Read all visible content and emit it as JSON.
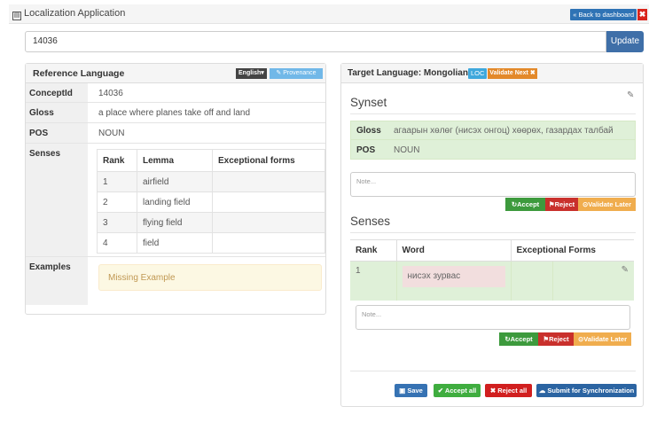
{
  "app": {
    "title": "Localization Application",
    "back_label": "« Back to dashboard",
    "close_label": "✖"
  },
  "search": {
    "value": "14036",
    "update_label": "Update"
  },
  "reference": {
    "title": "Reference Language",
    "lang_label": "English▾",
    "provenance_label": "✎ Provenance",
    "conceptid_label": "ConceptId",
    "conceptid": "14036",
    "gloss_label": "Gloss",
    "gloss": "a place where planes take off and land",
    "pos_label": "POS",
    "pos": "NOUN",
    "senses_label": "Senses",
    "senses_columns": [
      "Rank",
      "Lemma",
      "Exceptional forms"
    ],
    "senses": [
      {
        "rank": "1",
        "lemma": "airfield",
        "forms": ""
      },
      {
        "rank": "2",
        "lemma": "landing field",
        "forms": ""
      },
      {
        "rank": "3",
        "lemma": "flying field",
        "forms": ""
      },
      {
        "rank": "4",
        "lemma": "field",
        "forms": ""
      }
    ],
    "examples_label": "Examples",
    "missing_example": "Missing Example"
  },
  "target": {
    "title": "Target Language: Mongolian",
    "loc_badge": "LOC",
    "validate_next": "Validate Next ✖",
    "synset_title": "Synset",
    "gloss_label": "Gloss",
    "gloss": "агаарын хөлөг (нисэх онгоц) хөөрөх, газардах талбай",
    "pos_label": "POS",
    "pos": "NOUN",
    "note_placeholder": "Note...",
    "accept": "Accept",
    "reject": "Reject",
    "validate_later": "Validate Later",
    "senses_title": "Senses",
    "senses_columns": [
      "Rank",
      "Word",
      "Exceptional Forms"
    ],
    "senses": [
      {
        "rank": "1",
        "word": "нисэх зурвас"
      }
    ],
    "save": "Save",
    "accept_all": "Accept all",
    "reject_all": "Reject all",
    "submit": "Submit for Synchronization"
  },
  "colors": {
    "primary": "#3672b3",
    "success": "#3d9a3d",
    "danger": "#c9302c",
    "warning": "#f0ad4e",
    "synset_bg": "#dff0d8",
    "word_bg": "#f2dede",
    "missing_bg": "#fcf8e3"
  }
}
